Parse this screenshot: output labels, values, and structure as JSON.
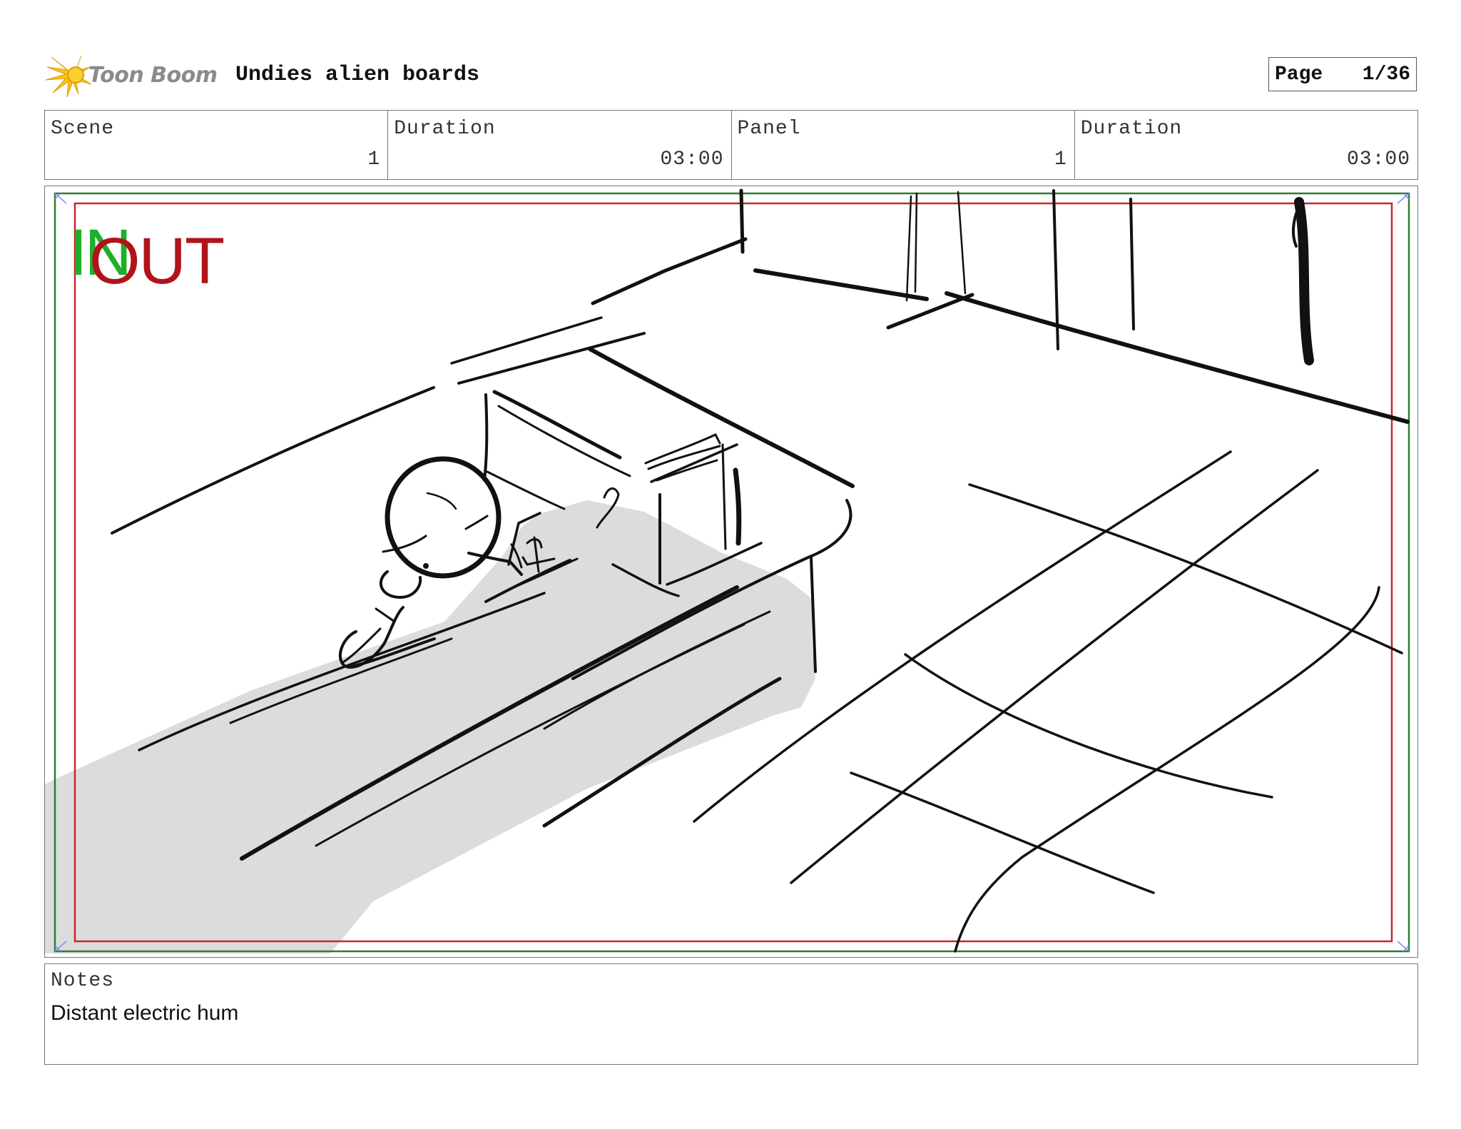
{
  "header": {
    "logo_text": "Toon Boom",
    "title": "Undies alien boards",
    "page_label": "Page",
    "page_value": "1/36"
  },
  "info": {
    "scene_label": "Scene",
    "scene_value": "1",
    "scene_duration_label": "Duration",
    "scene_duration_value": "03:00",
    "panel_label": "Panel",
    "panel_value": "1",
    "panel_duration_label": "Duration",
    "panel_duration_value": "03:00"
  },
  "panel": {
    "in_marker": "IN",
    "out_marker": "OUT",
    "colors": {
      "in_marker": "#1fae2a",
      "out_marker": "#b0141b",
      "safe_frame": "#2e7d32",
      "action_frame": "#c62828",
      "desk_shading": "#dcdcdf"
    }
  },
  "notes": {
    "label": "Notes",
    "text": "Distant electric hum"
  }
}
